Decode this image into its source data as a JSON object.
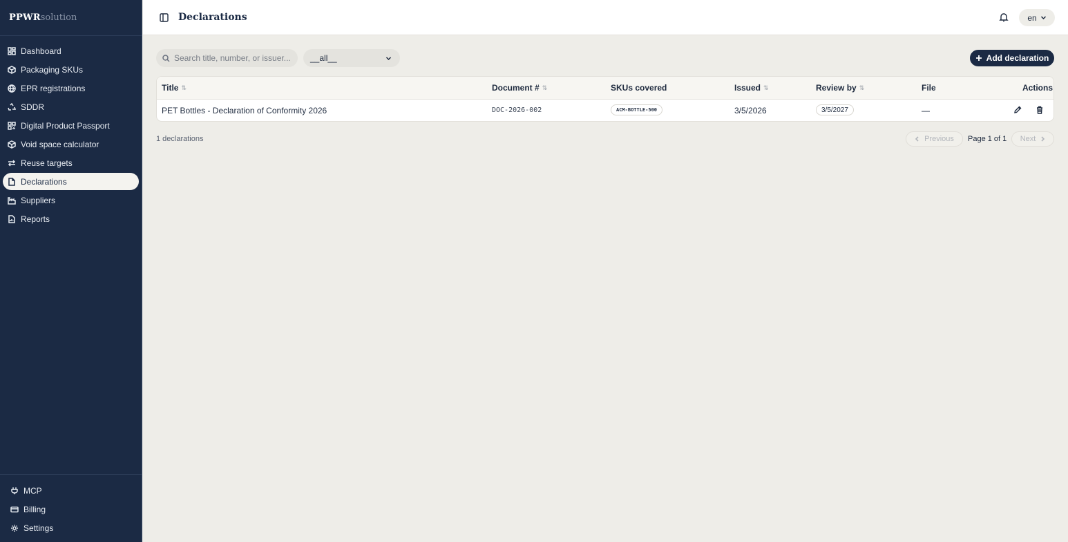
{
  "brand": {
    "part1": "PPWR",
    "part2": "solution"
  },
  "sidebar": {
    "items": [
      {
        "label": "Dashboard",
        "icon": "dashboard-icon"
      },
      {
        "label": "Packaging SKUs",
        "icon": "package-icon"
      },
      {
        "label": "EPR registrations",
        "icon": "globe-icon"
      },
      {
        "label": "SDDR",
        "icon": "recycle-icon"
      },
      {
        "label": "Digital Product Passport",
        "icon": "qr-code-icon"
      },
      {
        "label": "Void space calculator",
        "icon": "box-icon"
      },
      {
        "label": "Reuse targets",
        "icon": "repeat-icon"
      },
      {
        "label": "Declarations",
        "icon": "file-icon",
        "active": true
      },
      {
        "label": "Suppliers",
        "icon": "factory-icon"
      },
      {
        "label": "Reports",
        "icon": "report-icon"
      }
    ],
    "bottom": [
      {
        "label": "MCP",
        "icon": "plug-icon"
      },
      {
        "label": "Billing",
        "icon": "credit-card-icon"
      },
      {
        "label": "Settings",
        "icon": "gear-icon"
      }
    ]
  },
  "header": {
    "title": "Declarations",
    "language": "en"
  },
  "toolbar": {
    "search_placeholder": "Search title, number, or issuer...",
    "filter_value": "__all__",
    "add_label": "Add declaration"
  },
  "table": {
    "columns": [
      "Title",
      "Document #",
      "SKUs covered",
      "Issued",
      "Review by",
      "File",
      "Actions"
    ],
    "rows": [
      {
        "title": "PET Bottles - Declaration of Conformity 2026",
        "document": "DOC-2026-002",
        "skus": "ACM-BOTTLE-500",
        "issued": "3/5/2026",
        "review_by": "3/5/2027",
        "file": "—"
      }
    ]
  },
  "footer": {
    "count": "1 declarations",
    "previous": "Previous",
    "page_info": "Page 1 of 1",
    "next": "Next"
  }
}
